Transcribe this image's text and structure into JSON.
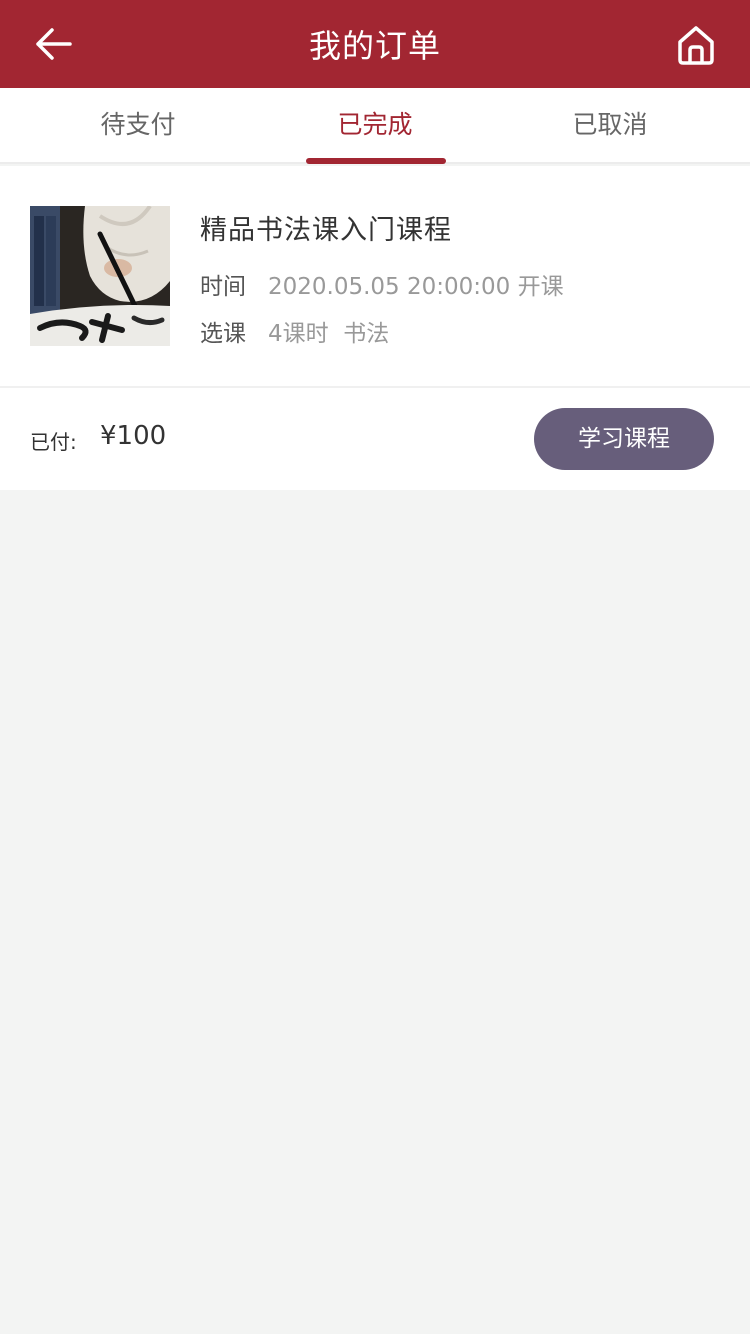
{
  "header": {
    "title": "我的订单",
    "back_icon": "arrow-left-icon",
    "home_icon": "home-icon",
    "bg_color": "#a22632"
  },
  "tabs": [
    {
      "label": "待支付",
      "active": false
    },
    {
      "label": "已完成",
      "active": true
    },
    {
      "label": "已取消",
      "active": false
    }
  ],
  "order": {
    "thumbnail": "calligraphy-photo",
    "course_name": "精品书法课入门课程",
    "time_label": "时间",
    "time_value": "2020.05.05 20:00:00 开课",
    "selection_label": "选课",
    "selection_value": "4课时  书法",
    "paid_label": "已付:",
    "paid_amount": "¥100",
    "action_button": "学习课程",
    "button_color": "#675e7b"
  }
}
